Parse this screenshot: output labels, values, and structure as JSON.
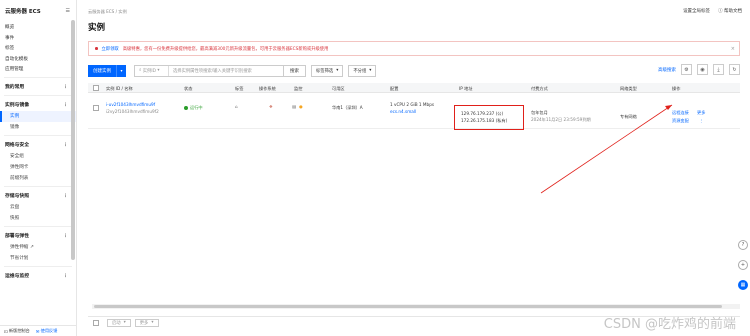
{
  "sidebar": {
    "title": "云服务器 ECS",
    "items": [
      "概览",
      "事件",
      "标签",
      "自动化模板",
      "应用管理"
    ],
    "groups": [
      {
        "label": "我的常用",
        "subs": []
      },
      {
        "label": "实例与镜像",
        "subs": [
          "实例",
          "镜像"
        ]
      },
      {
        "label": "网络与安全",
        "subs": [
          "安全组",
          "弹性网卡",
          "前缀列表"
        ]
      },
      {
        "label": "存储与快照",
        "subs": [
          "云盘",
          "快照"
        ]
      },
      {
        "label": "部署与弹性",
        "subs": [
          "弹性伸缩",
          "节省计划"
        ]
      },
      {
        "label": "运维与监控",
        "subs": []
      }
    ],
    "footer": {
      "left": "新版控制台",
      "right": "使用反馈"
    }
  },
  "header": {
    "breadcrumb": "云服务器 ECS / 实例",
    "title": "实例",
    "top_right": [
      "设置全局标签",
      "帮助文档"
    ]
  },
  "alert": {
    "link": "立即领取",
    "text": "高级特惠，您有一份免费升级提供给您，最高满减300元新升级流量包，可用于云服务器ECS新购或升级使用"
  },
  "toolbar": {
    "create": "创建实例",
    "search_prefix": "实例ID",
    "search_placeholder": "选择实例属性项搜索/输入关键字识别搜索",
    "search_btn": "搜索",
    "filter": "标签筛选",
    "category": "不分组",
    "advanced": "高级搜索"
  },
  "table": {
    "headers": [
      "实例 ID / 名称",
      "状态",
      "标签",
      "操作系统",
      "监控",
      "可用区",
      "配置",
      "IP 地址",
      "付费方式",
      "网络类型",
      "操作"
    ],
    "row": {
      "id": "i-uv2f1043lhmvdfimu9f",
      "name": "i2vy2f1043lhmvdfimu9f2",
      "status": "运行中",
      "zone": "华南1（深圳）A",
      "config": "1 vCPU 2 GiB 1 Mbps",
      "config_spec": "ecs.n4.small",
      "ip_public": "129.76.179.237 (公)",
      "ip_private": "172.26.175.183 (私有)",
      "billing": "包年包月",
      "billing_date": "2024年11月2日 23:59:59到期",
      "network": "专有网络",
      "ops": [
        "远程连接",
        "更多",
        "资源变配"
      ]
    }
  },
  "footer": {
    "btn1": "启动",
    "btn2": "更多"
  },
  "watermark": "CSDN @吃炸鸡的前端"
}
